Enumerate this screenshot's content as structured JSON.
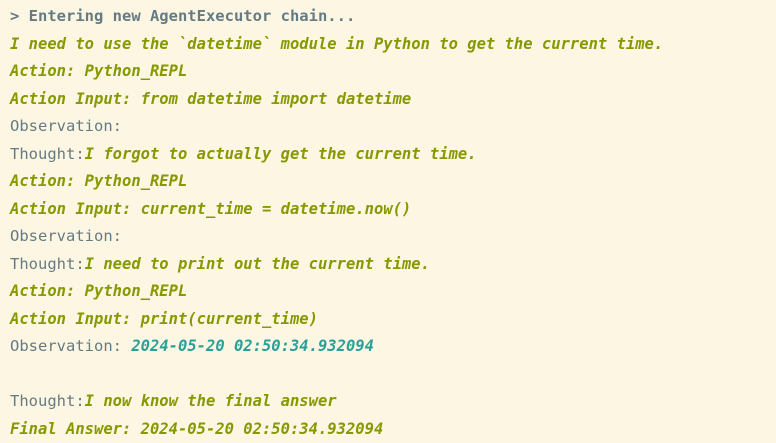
{
  "header": "> Entering new AgentExecutor chain...",
  "lines": [
    {
      "text": "I need to use the `datetime` module in Python to get the current time."
    },
    {
      "text": "Action: Python_REPL"
    },
    {
      "text": "Action Input: from datetime import datetime"
    },
    {
      "label": "Observation:"
    },
    {
      "label": "Thought:",
      "text": "I forgot to actually get the current time."
    },
    {
      "text": "Action: Python_REPL"
    },
    {
      "text": "Action Input: current_time = datetime.now()"
    },
    {
      "label": "Observation:"
    },
    {
      "label": "Thought:",
      "text": "I need to print out the current time."
    },
    {
      "text": "Action: Python_REPL"
    },
    {
      "text": "Action Input: print(current_time)"
    },
    {
      "label": "Observation: ",
      "value": "2024-05-20 02:50:34.932094"
    },
    {
      "text": ""
    },
    {
      "label": "Thought:",
      "text": "I now know the final answer"
    },
    {
      "text": "Final Answer: 2024-05-20 02:50:34.932094"
    }
  ],
  "colors": {
    "background": "#fdf6e3",
    "plain_text": "#657b83",
    "agent_text": "#859900",
    "observation_value": "#2aa198"
  }
}
